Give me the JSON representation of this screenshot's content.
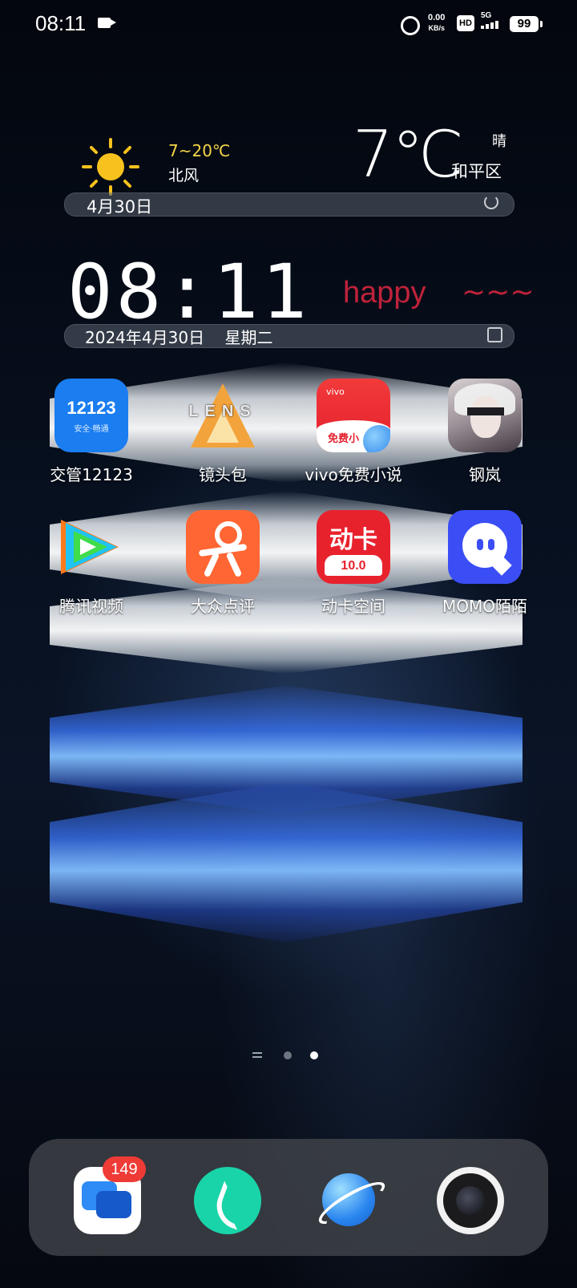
{
  "status_bar": {
    "time": "08:11",
    "net_speed_value": "0.00",
    "net_speed_unit": "KB/s",
    "hd": "HD",
    "network": "5G",
    "battery": "99"
  },
  "weather": {
    "temp_range": "7~20℃",
    "wind": "北风",
    "temperature": "7℃",
    "condition": "晴",
    "district": "和平区",
    "date": "4月30日"
  },
  "clock": {
    "time": "08:11",
    "greeting": "happy",
    "tilde": "~~~",
    "date_line": "2024年4月30日    星期二"
  },
  "apps_row1": [
    {
      "label": "交管12123",
      "icon_text": "12123",
      "icon_sub": "安全·畅通"
    },
    {
      "label": "镜头包",
      "icon_text": "LENS"
    },
    {
      "label": "vivo免费小说",
      "icon_brand": "vivo",
      "icon_text": "免费小"
    },
    {
      "label": "钢岚"
    }
  ],
  "apps_row2": [
    {
      "label": "腾讯视频"
    },
    {
      "label": "大众点评"
    },
    {
      "label": "动卡空间",
      "icon_text": "动卡",
      "icon_sub": "10.0"
    },
    {
      "label": "MOMO陌陌"
    }
  ],
  "page_indicator": {
    "pages": 2,
    "current": 2
  },
  "dock": {
    "messages_badge": "149",
    "items": [
      "messages-icon",
      "phone-icon",
      "browser-icon",
      "camera-icon"
    ]
  },
  "colors": {
    "accent_red": "#c0223b",
    "temp_yellow": "#f7d64a"
  }
}
